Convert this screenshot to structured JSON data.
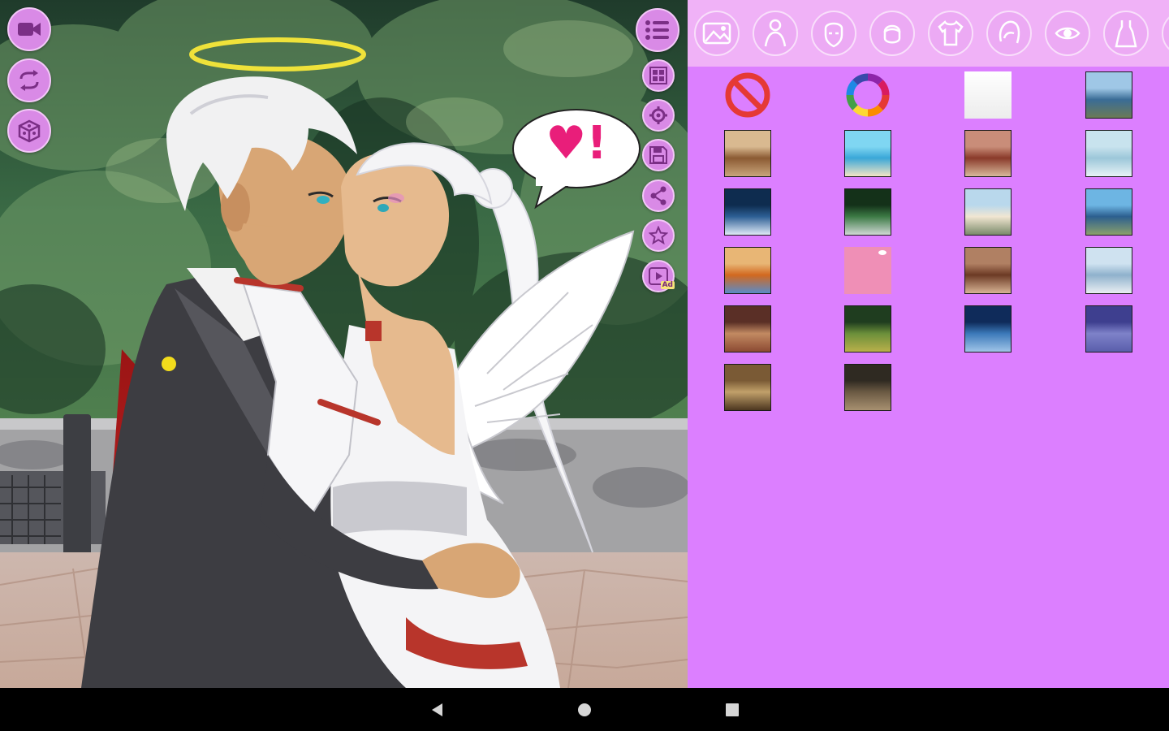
{
  "scene": {
    "speech_bubble": {
      "text": "♥!",
      "heart_color": "#e91e7a"
    },
    "left_buttons": [
      {
        "name": "video-record-button",
        "icon": "video-camera-icon"
      },
      {
        "name": "swap-characters-button",
        "icon": "swap-arrows-icon"
      },
      {
        "name": "random-dice-button",
        "icon": "dice-icon"
      }
    ],
    "right_buttons": [
      {
        "name": "menu-button",
        "icon": "list-menu-icon"
      },
      {
        "name": "gallery-button",
        "icon": "grid-gallery-icon"
      },
      {
        "name": "settings-button",
        "icon": "gear-icon"
      },
      {
        "name": "save-button",
        "icon": "floppy-disk-icon"
      },
      {
        "name": "share-button",
        "icon": "share-icon"
      },
      {
        "name": "rate-button",
        "icon": "star-icon"
      },
      {
        "name": "watch-ad-button",
        "icon": "play-video-icon",
        "badge": "Ad"
      }
    ]
  },
  "panel": {
    "colors": {
      "background": "#dc7fff",
      "category_bar": "#f0b2f7",
      "button": "#ecaaf4"
    },
    "categories": [
      {
        "name": "category-backgrounds",
        "icon": "background-scene-icon",
        "selected": true
      },
      {
        "name": "category-body",
        "icon": "body-icon"
      },
      {
        "name": "category-face",
        "icon": "face-icon"
      },
      {
        "name": "category-hair",
        "icon": "hair-icon"
      },
      {
        "name": "category-tops",
        "icon": "shirt-icon"
      },
      {
        "name": "category-hairstyle",
        "icon": "hairstyle-icon"
      },
      {
        "name": "category-eyes",
        "icon": "eyes-icon"
      },
      {
        "name": "category-dress",
        "icon": "dress-icon"
      },
      {
        "name": "category-more",
        "icon": "more-icon"
      }
    ],
    "thumbnails": [
      {
        "kind": "none",
        "icon": "no-background-icon"
      },
      {
        "kind": "color",
        "icon": "color-wheel-icon"
      },
      {
        "kind": "white",
        "colors": [
          "#ffffff",
          "#ececec"
        ]
      },
      {
        "kind": "scene",
        "colors": [
          "#9fc7e6",
          "#3a6c96",
          "#6b7a57"
        ]
      },
      {
        "kind": "scene",
        "colors": [
          "#d9b990",
          "#8b5a33",
          "#c9a57a"
        ]
      },
      {
        "kind": "scene",
        "colors": [
          "#7fd6f2",
          "#3aa7d8",
          "#f3e6c4"
        ]
      },
      {
        "kind": "scene",
        "colors": [
          "#c98d79",
          "#8a3a2a",
          "#d8b89a"
        ]
      },
      {
        "kind": "scene",
        "colors": [
          "#c8e3ee",
          "#9cc7d9",
          "#e7f2f6"
        ]
      },
      {
        "kind": "scene",
        "colors": [
          "#0e2c4f",
          "#2d5f94",
          "#dfeaf7"
        ]
      },
      {
        "kind": "scene",
        "colors": [
          "#143119",
          "#3c7a45",
          "#cfd8d3"
        ]
      },
      {
        "kind": "scene",
        "colors": [
          "#b9d8ec",
          "#f1e6d2",
          "#7a8a6a"
        ]
      },
      {
        "kind": "scene",
        "colors": [
          "#6db5e3",
          "#2c5f8f",
          "#8aa06c"
        ]
      },
      {
        "kind": "scene",
        "colors": [
          "#e8b675",
          "#d2681f",
          "#5a8bc7"
        ]
      },
      {
        "kind": "pink",
        "colors": [
          "#ef8fb6",
          "#f3a6c6"
        ]
      },
      {
        "kind": "scene",
        "colors": [
          "#b08063",
          "#6c3a24",
          "#d7b394"
        ]
      },
      {
        "kind": "scene",
        "colors": [
          "#cfe2f0",
          "#8fb1cc",
          "#e9eff3"
        ]
      },
      {
        "kind": "scene",
        "colors": [
          "#5a2f26",
          "#c28a62",
          "#8c4a32"
        ]
      },
      {
        "kind": "scene",
        "colors": [
          "#1f3d1f",
          "#6b8f3a",
          "#b9b04a"
        ]
      },
      {
        "kind": "scene",
        "colors": [
          "#0f2b5a",
          "#3b79b9",
          "#9fc4e8"
        ]
      },
      {
        "kind": "scene",
        "colors": [
          "#3e3f8f",
          "#7e82c9",
          "#5a5eab"
        ]
      },
      {
        "kind": "scene",
        "colors": [
          "#7a5a35",
          "#c1a06a",
          "#4d3720"
        ]
      },
      {
        "kind": "scene",
        "colors": [
          "#2f2a22",
          "#6b5a43",
          "#a79070"
        ]
      }
    ]
  },
  "navbar": {
    "keys": [
      {
        "name": "back-button",
        "icon": "back-triangle-icon"
      },
      {
        "name": "home-button",
        "icon": "home-circle-icon"
      },
      {
        "name": "recents-button",
        "icon": "recents-square-icon"
      }
    ]
  }
}
